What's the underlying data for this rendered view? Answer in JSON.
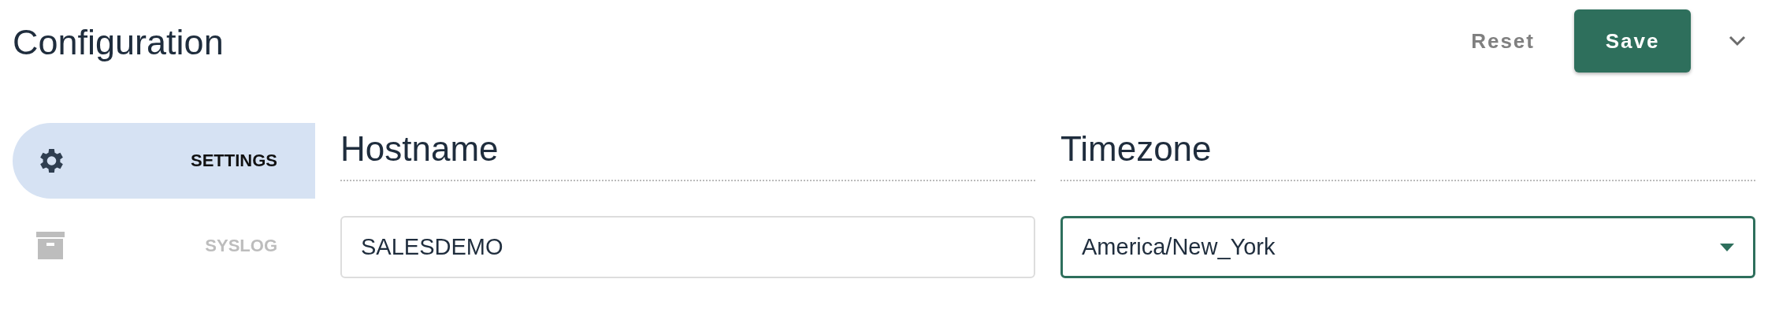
{
  "title": "Configuration",
  "actions": {
    "reset": "Reset",
    "save": "Save"
  },
  "sidebar": {
    "items": [
      {
        "label": "SETTINGS",
        "kind": "gear",
        "selected": true
      },
      {
        "label": "SYSLOG",
        "kind": "archive",
        "selected": false
      }
    ]
  },
  "fields": [
    {
      "label": "Hostname",
      "kind": "text",
      "value": "SALESDEMO",
      "focused": false
    },
    {
      "label": "Timezone",
      "kind": "select",
      "value": "America/New_York",
      "focused": true
    }
  ]
}
